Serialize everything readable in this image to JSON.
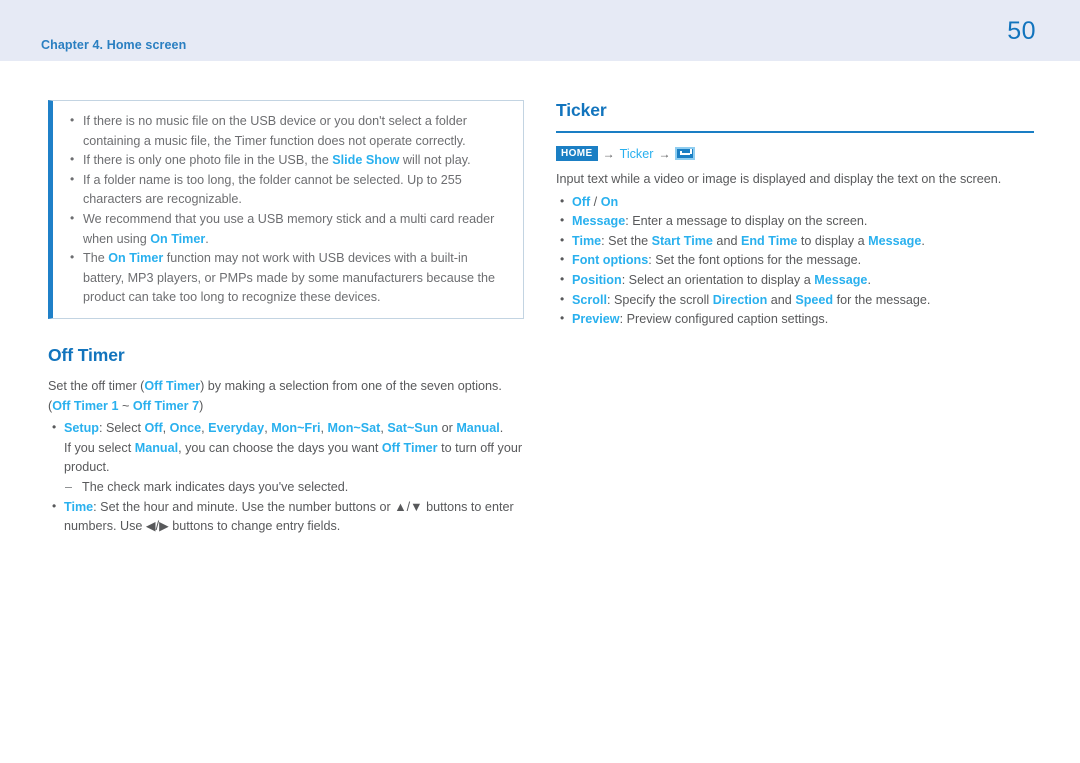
{
  "header": {
    "chapter": "Chapter 4. Home screen",
    "page_number": "50",
    "band_color": "#e6eaf5",
    "accent_color": "#29b0ee",
    "heading_color": "#1274bd"
  },
  "left_column": {
    "note_box": {
      "items": [
        {
          "segments": [
            {
              "text": "If there is no music file on the USB device or you don't select a folder containing a music file, the Timer function does not operate correctly.",
              "accent": false
            }
          ]
        },
        {
          "segments": [
            {
              "text": "If there is only one photo file in the USB, the ",
              "accent": false
            },
            {
              "text": "Slide Show",
              "accent": true
            },
            {
              "text": " will not play.",
              "accent": false
            }
          ]
        },
        {
          "segments": [
            {
              "text": "If a folder name is too long, the folder cannot be selected. Up to 255 characters are recognizable.",
              "accent": false
            }
          ]
        },
        {
          "segments": [
            {
              "text": "We recommend that you use a USB memory stick and a multi card reader when using ",
              "accent": false
            },
            {
              "text": "On Timer",
              "accent": true
            },
            {
              "text": ".",
              "accent": false
            }
          ]
        },
        {
          "segments": [
            {
              "text": "The ",
              "accent": false
            },
            {
              "text": "On Timer",
              "accent": true
            },
            {
              "text": " function may not work with USB devices with a built-in battery, MP3 players, or PMPs made by some manufacturers because the product can take too long to recognize these devices.",
              "accent": false
            }
          ]
        }
      ]
    },
    "section": {
      "heading": "Off Timer",
      "intro_segments": [
        {
          "text": "Set the off timer (",
          "accent": false
        },
        {
          "text": "Off Timer",
          "accent": true
        },
        {
          "text": ") by making a selection from one of the seven options. (",
          "accent": false
        },
        {
          "text": "Off Timer 1",
          "accent": true
        },
        {
          "text": " ~ ",
          "accent": false
        },
        {
          "text": "Off Timer 7",
          "accent": true
        },
        {
          "text": ")",
          "accent": false
        }
      ],
      "bullets": [
        {
          "segments": [
            {
              "text": "Setup",
              "accent": true
            },
            {
              "text": ": Select ",
              "accent": false
            },
            {
              "text": "Off",
              "accent": true
            },
            {
              "text": ", ",
              "accent": false
            },
            {
              "text": "Once",
              "accent": true
            },
            {
              "text": ", ",
              "accent": false
            },
            {
              "text": "Everyday",
              "accent": true
            },
            {
              "text": ", ",
              "accent": false
            },
            {
              "text": "Mon~Fri",
              "accent": true
            },
            {
              "text": ", ",
              "accent": false
            },
            {
              "text": "Mon~Sat",
              "accent": true
            },
            {
              "text": ", ",
              "accent": false
            },
            {
              "text": "Sat~Sun",
              "accent": true
            },
            {
              "text": " or ",
              "accent": false
            },
            {
              "text": "Manual",
              "accent": true
            },
            {
              "text": ".",
              "accent": false
            }
          ],
          "continuation_segments": [
            {
              "text": "If you select ",
              "accent": false
            },
            {
              "text": "Manual",
              "accent": true
            },
            {
              "text": ", you can choose the days you want ",
              "accent": false
            },
            {
              "text": "Off Timer",
              "accent": true
            },
            {
              "text": " to turn off your product.",
              "accent": false
            }
          ],
          "sub_bullets": [
            {
              "segments": [
                {
                  "text": "The check mark indicates days you've selected.",
                  "accent": false
                }
              ]
            }
          ]
        },
        {
          "segments": [
            {
              "text": "Time",
              "accent": true
            },
            {
              "text": ": Set the hour and minute. Use the number buttons or ▲/▼ buttons to enter numbers. Use ◀/▶ buttons to change entry fields.",
              "accent": false
            }
          ],
          "continuation_segments": [],
          "sub_bullets": []
        }
      ]
    }
  },
  "right_column": {
    "section": {
      "heading": "Ticker",
      "breadcrumb": {
        "home_label": "HOME",
        "arrow": "→",
        "middle_label": "Ticker",
        "end_icon_name": "enter-key-icon"
      },
      "intro": "Input text while a video or image is displayed and display the text on the screen.",
      "bullets": [
        {
          "segments": [
            {
              "text": "Off",
              "accent": true
            },
            {
              "text": " / ",
              "accent": false
            },
            {
              "text": "On",
              "accent": true
            }
          ]
        },
        {
          "segments": [
            {
              "text": "Message",
              "accent": true
            },
            {
              "text": ": Enter a message to display on the screen.",
              "accent": false
            }
          ]
        },
        {
          "segments": [
            {
              "text": "Time",
              "accent": true
            },
            {
              "text": ": Set the ",
              "accent": false
            },
            {
              "text": "Start Time",
              "accent": true
            },
            {
              "text": " and ",
              "accent": false
            },
            {
              "text": "End Time",
              "accent": true
            },
            {
              "text": " to display a ",
              "accent": false
            },
            {
              "text": "Message",
              "accent": true
            },
            {
              "text": ".",
              "accent": false
            }
          ]
        },
        {
          "segments": [
            {
              "text": "Font options",
              "accent": true
            },
            {
              "text": ": Set the font options for the message.",
              "accent": false
            }
          ]
        },
        {
          "segments": [
            {
              "text": "Position",
              "accent": true
            },
            {
              "text": ": Select an orientation to display a ",
              "accent": false
            },
            {
              "text": "Message",
              "accent": true
            },
            {
              "text": ".",
              "accent": false
            }
          ]
        },
        {
          "segments": [
            {
              "text": "Scroll",
              "accent": true
            },
            {
              "text": ": Specify the scroll ",
              "accent": false
            },
            {
              "text": "Direction",
              "accent": true
            },
            {
              "text": " and ",
              "accent": false
            },
            {
              "text": "Speed",
              "accent": true
            },
            {
              "text": " for the message.",
              "accent": false
            }
          ]
        },
        {
          "segments": [
            {
              "text": "Preview",
              "accent": true
            },
            {
              "text": ": Preview configured caption settings.",
              "accent": false
            }
          ]
        }
      ]
    }
  }
}
